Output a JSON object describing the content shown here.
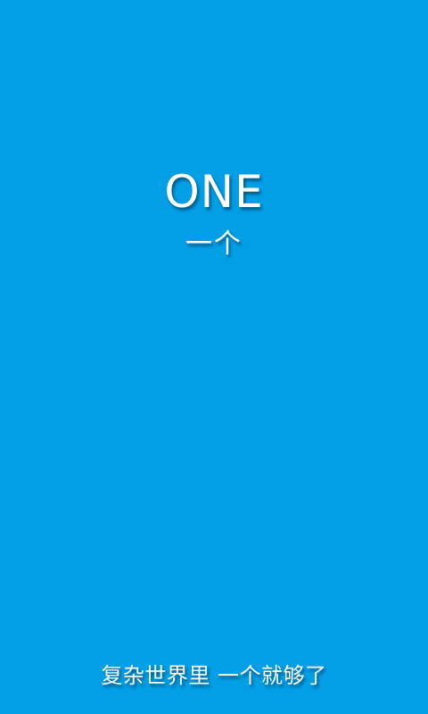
{
  "splash": {
    "logo_en": "ONE",
    "logo_cn": "一个",
    "slogan": "复杂世界里 一个就够了"
  },
  "colors": {
    "background": "#029ee6",
    "text": "#ffffff"
  }
}
